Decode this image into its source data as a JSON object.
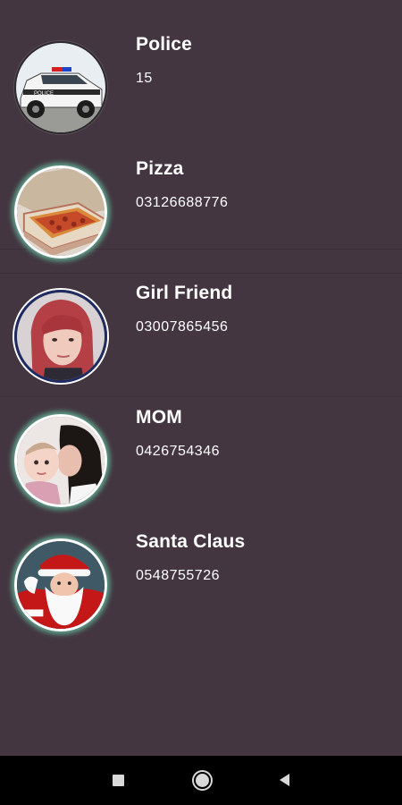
{
  "contacts": [
    {
      "name": "Police",
      "number": "15",
      "avatar_icon": "police-car-photo"
    },
    {
      "name": "Pizza",
      "number": "03126688776",
      "avatar_icon": "pizza-box-photo"
    },
    {
      "name": "Girl Friend",
      "number": "03007865456",
      "avatar_icon": "red-hair-woman-photo"
    },
    {
      "name": "MOM",
      "number": "0426754346",
      "avatar_icon": "mother-baby-photo"
    },
    {
      "name": "Santa Claus",
      "number": "0548755726",
      "avatar_icon": "santa-claus-photo"
    }
  ],
  "colors": {
    "background": "#433640",
    "text": "#ffffff",
    "avatar_glow": "#5fa68e",
    "navbar": "#000000"
  },
  "navbar": {
    "recents_icon": "square-recents-icon",
    "home_icon": "circle-home-icon",
    "back_icon": "triangle-back-icon"
  }
}
